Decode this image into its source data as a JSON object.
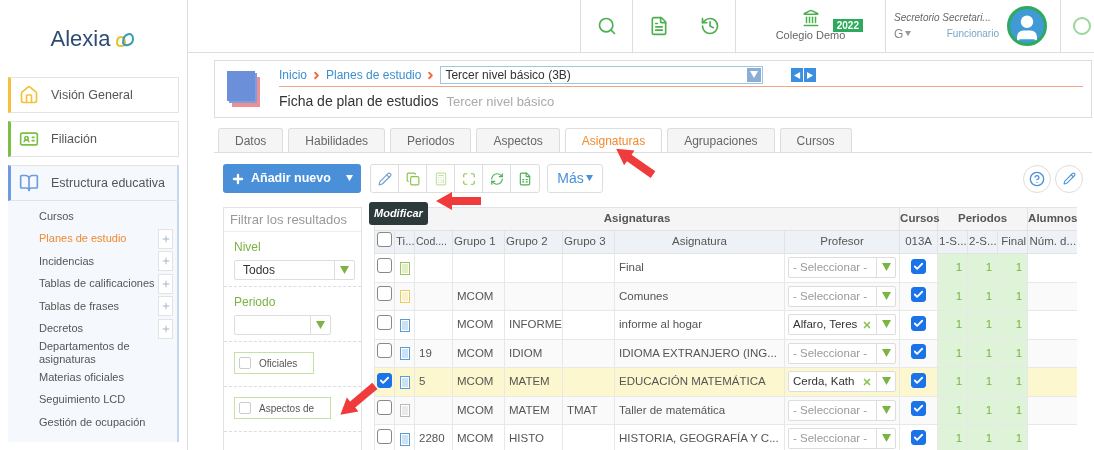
{
  "logo": {
    "text": "Alexia"
  },
  "sidebar": {
    "sections": [
      {
        "label": "Visión General",
        "color": "#f2c23a",
        "expanded": false
      },
      {
        "label": "Filiación",
        "color": "#7cbf45",
        "expanded": false
      },
      {
        "label": "Estructura educativa",
        "color": "#6f9be0",
        "expanded": true,
        "children": [
          {
            "label": "Cursos",
            "selected": false,
            "add": false
          },
          {
            "label": "Planes de estudio",
            "selected": true,
            "add": true
          },
          {
            "label": "Incidencias",
            "selected": false,
            "add": true
          },
          {
            "label": "Tablas de calificaciones",
            "selected": false,
            "add": true
          },
          {
            "label": "Tablas de frases",
            "selected": false,
            "add": true
          },
          {
            "label": "Decretos",
            "selected": false,
            "add": true
          },
          {
            "label": "Departamentos de asignaturas",
            "selected": false,
            "add": false
          },
          {
            "label": "Materias oficiales",
            "selected": false,
            "add": false
          },
          {
            "label": "Seguimiento LCD",
            "selected": false,
            "add": false
          },
          {
            "label": "Gestión de ocupación",
            "selected": false,
            "add": false
          }
        ]
      }
    ]
  },
  "topbar": {
    "school": {
      "name": "Colegio Demo",
      "year": "2022"
    },
    "user": {
      "name": "Secretorio Secretari...",
      "role": "Funcionario",
      "lang": "G"
    }
  },
  "header": {
    "breadcrumb": [
      "Inicio",
      "Planes de estudio"
    ],
    "selector": "Tercer nivel básico (3B)",
    "title": "Ficha de plan de estudios",
    "subtitle": "Tercer nivel básico"
  },
  "tabs": [
    {
      "label": "Datos",
      "selected": false
    },
    {
      "label": "Habilidades",
      "selected": false
    },
    {
      "label": "Periodos",
      "selected": false
    },
    {
      "label": "Aspectos",
      "selected": false
    },
    {
      "label": "Asignaturas",
      "selected": true
    },
    {
      "label": "Agrupaciones",
      "selected": false
    },
    {
      "label": "Cursos",
      "selected": false
    }
  ],
  "toolbar": {
    "add_button": "Añadir nuevo",
    "more_button": "Más",
    "tooltip": "Modificar"
  },
  "filter": {
    "placeholder": "Filtrar los resultados",
    "fields": [
      {
        "kind": "select",
        "label": "Nivel",
        "value": "Todos"
      },
      {
        "kind": "select",
        "label": "Periodo"
      },
      {
        "kind": "checkbox",
        "label": "Oficiales",
        "checked": false
      },
      {
        "kind": "checkbox",
        "label": "Aspectos de",
        "checked": false
      }
    ]
  },
  "table": {
    "header_checked": false,
    "groups": [
      "Asignaturas",
      "Cursos",
      "Periodos",
      "Alumnos"
    ],
    "columns": [
      "Ti...",
      "Cod....",
      "Grupo 1",
      "Grupo 2",
      "Grupo 3",
      "Asignatura",
      "Profesor",
      "013A",
      "1-S...",
      "2-S...",
      "Final",
      "Núm. d..."
    ],
    "rows": [
      {
        "checked": false,
        "selected": false,
        "color": "#9cc65a",
        "code": "",
        "group_1": "",
        "group_2": "",
        "group_3": "",
        "subject": "Final",
        "teacher": {
          "placeholder": "- Seleccionar -"
        },
        "course": true,
        "periods": [
          "1",
          "1",
          "1"
        ]
      },
      {
        "checked": false,
        "selected": false,
        "color": "#e8cf5a",
        "code": "",
        "group_1": "MCOM",
        "group_2": "",
        "group_3": "",
        "subject": "Comunes",
        "teacher": {
          "placeholder": "- Seleccionar -"
        },
        "course": true,
        "periods": [
          "1",
          "1",
          "1"
        ]
      },
      {
        "checked": false,
        "selected": false,
        "color": "#5b9bd5",
        "code": "",
        "group_1": "MCOM",
        "group_2": "INFORME",
        "group_3": "",
        "subject": "informe al hogar",
        "teacher": {
          "value": "Alfaro, Teres"
        },
        "course": true,
        "periods": [
          "1",
          "1",
          "1"
        ]
      },
      {
        "checked": false,
        "selected": false,
        "color": "#5b9bd5",
        "code": "19",
        "group_1": "MCOM",
        "group_2": "IDIOM",
        "group_3": "",
        "subject": "IDIOMA EXTRANJERO (ING...",
        "teacher": {
          "placeholder": "- Seleccionar -"
        },
        "course": true,
        "periods": [
          "1",
          "1",
          "1"
        ]
      },
      {
        "checked": true,
        "selected": true,
        "color": "#5b9bd5",
        "code": "5",
        "group_1": "MCOM",
        "group_2": "MATEM",
        "group_3": "",
        "subject": "EDUCACIÓN MATEMÁTICA",
        "teacher": {
          "value": "Cerda, Kath"
        },
        "course": true,
        "periods": [
          "1",
          "1",
          "1"
        ]
      },
      {
        "checked": false,
        "selected": false,
        "color": "#b9b9b9",
        "code": "",
        "group_1": "MCOM",
        "group_2": "MATEM",
        "group_3": "TMAT",
        "subject": "Taller de matemática",
        "teacher": {
          "placeholder": "- Seleccionar -"
        },
        "course": true,
        "periods": [
          "1",
          "1",
          "1"
        ]
      },
      {
        "checked": false,
        "selected": false,
        "color": "#5b9bd5",
        "code": "2280",
        "group_1": "MCOM",
        "group_2": "HISTO",
        "group_3": "",
        "subject": "HISTORIA, GEOGRAFÍA Y C...",
        "teacher": {
          "placeholder": "- Seleccionar -"
        },
        "course": true,
        "periods": [
          "1",
          "1",
          "1"
        ]
      }
    ]
  }
}
